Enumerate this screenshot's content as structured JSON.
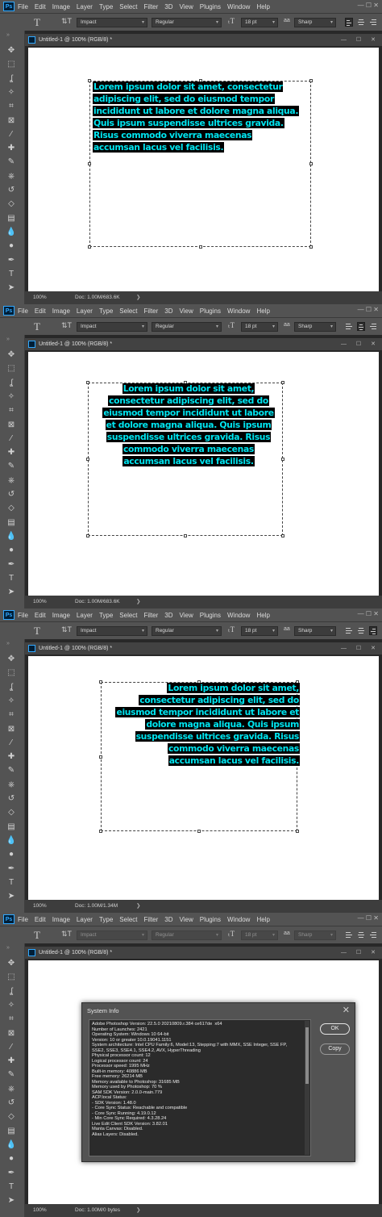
{
  "app": {
    "logo": "Ps",
    "menu": [
      "File",
      "Edit",
      "Image",
      "Layer",
      "Type",
      "Select",
      "Filter",
      "3D",
      "View",
      "Plugins",
      "Window",
      "Help"
    ],
    "window_controls": "—   ☐   ✕"
  },
  "options": {
    "font_family": "Impact",
    "font_style": "Regular",
    "font_size": "18 pt",
    "anti_alias_label": "aa",
    "anti_alias": "Sharp"
  },
  "document": {
    "tab_title": "Untitled-1 @ 100% (RGB/8) *",
    "tab_controls": "— ☐ ✕",
    "zoom": "100%"
  },
  "text_lines_left": [
    "Lorem ipsum dolor sit amet, consectetur",
    "adipiscing elit, sed do eiusmod tempor",
    "incididunt ut labore et dolore magna aliqua.",
    "Quis ipsum suspendisse ultrices gravida.",
    "Risus commodo viverra maecenas",
    "accumsan lacus vel facilisis."
  ],
  "text_lines_center": [
    "Lorem ipsum dolor sit amet,",
    "consectetur adipiscing elit, sed do",
    "eiusmod tempor incididunt ut labore",
    "et dolore magna aliqua. Quis ipsum",
    "suspendisse ultrices gravida. Risus",
    "commodo viverra maecenas",
    "accumsan lacus vel facilisis."
  ],
  "text_lines_right": [
    "Lorem ipsum dolor sit amet,",
    "consectetur adipiscing elit, sed do",
    "eiusmod tempor incididunt ut labore et",
    "dolore magna aliqua. Quis ipsum",
    "suspendisse ultrices gravida. Risus",
    "commodo viverra maecenas",
    "accumsan lacus vel facilisis."
  ],
  "panels": [
    {
      "doc_size": "Doc: 1.00M/683.6K"
    },
    {
      "doc_size": "Doc: 1.00M/683.6K"
    },
    {
      "doc_size": "Doc: 1.00M/1.34M"
    },
    {
      "doc_size": "Doc: 1.00M/0 bytes"
    }
  ],
  "system_info": {
    "title": "System Info",
    "ok_label": "OK",
    "copy_label": "Copy",
    "lines": [
      "Adobe Photoshop Version: 22.5.0 20210809.r.384 ce617de  x64",
      "Number of Launches: 2421",
      "Operating System: Windows 10 64-bit",
      "Version: 10 or greater 10.0.19041.1151",
      "System architecture: Intel CPU Family:6, Model:13, Stepping:7 with MMX, SSE Integer, SSE FP,",
      "SSE2, SSE3, SSE4.1, SSE4.2, AVX, HyperThreading",
      "Physical processor count: 12",
      "Logical processor count: 24",
      "Processor speed: 1995 MHz",
      "Built-in memory: 40886 MB",
      "Free memory: 26214 MB",
      "Memory available to Photoshop: 31685 MB",
      "Memory used by Photoshop: 70 %",
      "SAM SDK Version: 2.0.0-main.779",
      "ACP.local Status:",
      "- SDK Version: 1.48.0",
      "- Core Sync Status: Reachable and compatible",
      "- Core Sync Running: 4.19.0.12",
      "- Min Core Sync Required: 4.3.28.24",
      "Live Edit Client SDK Version: 3.82.01",
      "Manta Canvas: Disabled.",
      "Alias Layers: Disabled."
    ]
  },
  "tools": [
    "move-tool",
    "marquee-tool",
    "lasso-tool",
    "quick-select-tool",
    "crop-tool",
    "frame-tool",
    "eyedropper-tool",
    "healing-brush-tool",
    "brush-tool",
    "clone-stamp-tool",
    "history-brush-tool",
    "eraser-tool",
    "gradient-tool",
    "blur-tool",
    "dodge-tool",
    "pen-tool",
    "type-tool",
    "path-select-tool"
  ],
  "colors": {
    "text": "#00e5f0",
    "highlight": "#000000",
    "ui": "#535353"
  }
}
